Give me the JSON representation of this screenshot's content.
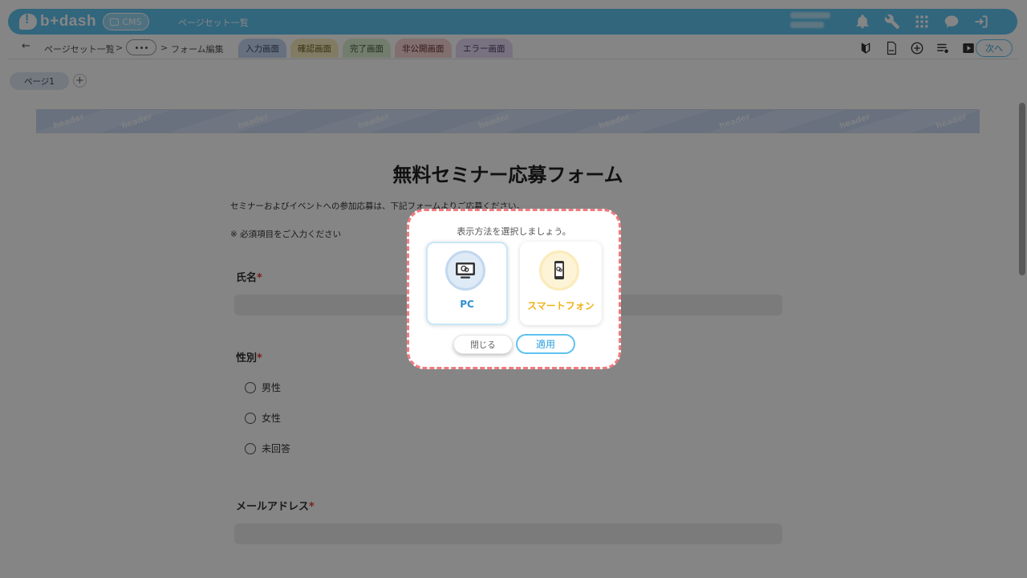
{
  "app": {
    "logo_text": "b+dash",
    "cms_label": "CMS",
    "top_title": "ページセット一覧"
  },
  "top_icons": [
    "bell-icon",
    "wrench-icon",
    "grid-icon",
    "chat-icon",
    "logout-icon"
  ],
  "breadcrumb": {
    "back": "←",
    "item1": "ページセット一覧",
    "sep": ">",
    "item3": "フォーム編集"
  },
  "tabs": [
    {
      "label": "入力画面",
      "bg": "#c5d7f1",
      "color": "#3a4a66"
    },
    {
      "label": "確認画面",
      "bg": "#f9ecc0",
      "color": "#6b5b1e"
    },
    {
      "label": "完了画面",
      "bg": "#dcefd4",
      "color": "#3e5b33"
    },
    {
      "label": "非公開画面",
      "bg": "#f8d5d5",
      "color": "#6b2e2e"
    },
    {
      "label": "エラー画面",
      "bg": "#e6d9f3",
      "color": "#4f3a6b"
    }
  ],
  "toolbar_right": {
    "next_label": "次へ"
  },
  "pages": {
    "chip_label": "ページ1",
    "add_label": "+"
  },
  "form": {
    "header_word": "header",
    "title": "無料セミナー応募フォーム",
    "description": "セミナーおよびイベントへの参加応募は、下記フォームよりご応募ください。",
    "required_note": "※ 必須項目をご入力ください",
    "name_label": "氏名",
    "gender_label": "性別",
    "gender_options": [
      "男性",
      "女性",
      "未回答"
    ],
    "email_label": "メールアドレス",
    "required_mark": "*"
  },
  "modal": {
    "prompt": "表示方法を選択しましょう。",
    "option_pc": "PC",
    "option_sp": "スマートフォン",
    "close_label": "閉じる",
    "apply_label": "適用",
    "border_color": "#f07a7f"
  }
}
